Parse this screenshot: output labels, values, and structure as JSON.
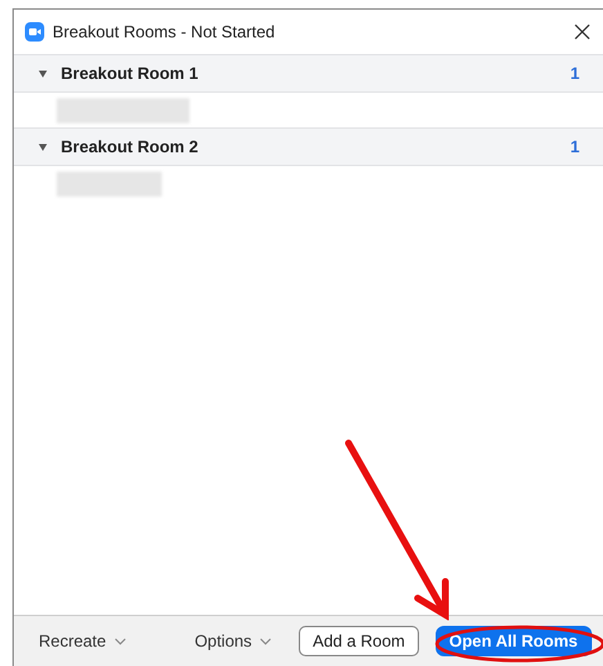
{
  "window": {
    "title": "Breakout Rooms - Not Started"
  },
  "rooms": [
    {
      "name": "Breakout Room 1",
      "count": "1",
      "expanded": true
    },
    {
      "name": "Breakout Room 2",
      "count": "1",
      "expanded": true
    }
  ],
  "footer": {
    "dropdowns": [
      "Recreate",
      "Options"
    ],
    "secondary_button": "Add a Room",
    "primary_button": "Open All Rooms"
  }
}
